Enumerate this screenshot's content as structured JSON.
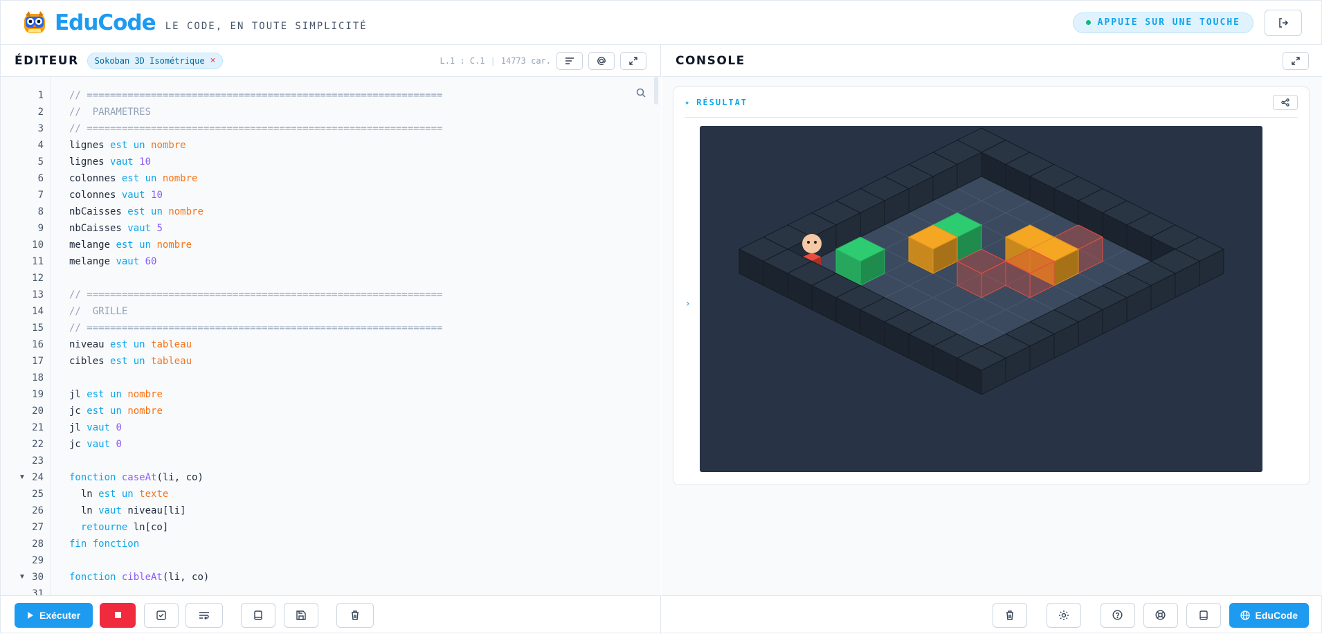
{
  "header": {
    "brand": "EduCode",
    "tagline": "LE CODE, EN TOUTE SIMPLICITÉ",
    "key_prompt": "APPUIE SUR UNE TOUCHE"
  },
  "editor": {
    "title": "ÉDITEUR",
    "file_tag": "Sokoban 3D Isométrique",
    "file_tag_close": "×",
    "cursor_pos": "L.1 : C.1",
    "char_count": "14773 car.",
    "lines": [
      {
        "n": "1",
        "tokens": [
          {
            "c": "t-comment",
            "t": "// ============================================================="
          }
        ]
      },
      {
        "n": "2",
        "tokens": [
          {
            "c": "t-comment",
            "t": "//  PARAMETRES"
          }
        ]
      },
      {
        "n": "3",
        "tokens": [
          {
            "c": "t-comment",
            "t": "// ============================================================="
          }
        ]
      },
      {
        "n": "4",
        "tokens": [
          {
            "c": "t-ident",
            "t": "lignes "
          },
          {
            "c": "t-kw",
            "t": "est un "
          },
          {
            "c": "t-type",
            "t": "nombre"
          }
        ]
      },
      {
        "n": "5",
        "tokens": [
          {
            "c": "t-ident",
            "t": "lignes "
          },
          {
            "c": "t-kw",
            "t": "vaut "
          },
          {
            "c": "t-num",
            "t": "10"
          }
        ]
      },
      {
        "n": "6",
        "tokens": [
          {
            "c": "t-ident",
            "t": "colonnes "
          },
          {
            "c": "t-kw",
            "t": "est un "
          },
          {
            "c": "t-type",
            "t": "nombre"
          }
        ]
      },
      {
        "n": "7",
        "tokens": [
          {
            "c": "t-ident",
            "t": "colonnes "
          },
          {
            "c": "t-kw",
            "t": "vaut "
          },
          {
            "c": "t-num",
            "t": "10"
          }
        ]
      },
      {
        "n": "8",
        "tokens": [
          {
            "c": "t-ident",
            "t": "nbCaisses "
          },
          {
            "c": "t-kw",
            "t": "est un "
          },
          {
            "c": "t-type",
            "t": "nombre"
          }
        ]
      },
      {
        "n": "9",
        "tokens": [
          {
            "c": "t-ident",
            "t": "nbCaisses "
          },
          {
            "c": "t-kw",
            "t": "vaut "
          },
          {
            "c": "t-num",
            "t": "5"
          }
        ]
      },
      {
        "n": "10",
        "tokens": [
          {
            "c": "t-ident",
            "t": "melange "
          },
          {
            "c": "t-kw",
            "t": "est un "
          },
          {
            "c": "t-type",
            "t": "nombre"
          }
        ]
      },
      {
        "n": "11",
        "tokens": [
          {
            "c": "t-ident",
            "t": "melange "
          },
          {
            "c": "t-kw",
            "t": "vaut "
          },
          {
            "c": "t-num",
            "t": "60"
          }
        ]
      },
      {
        "n": "12",
        "tokens": []
      },
      {
        "n": "13",
        "tokens": [
          {
            "c": "t-comment",
            "t": "// ============================================================="
          }
        ]
      },
      {
        "n": "14",
        "tokens": [
          {
            "c": "t-comment",
            "t": "//  GRILLE"
          }
        ]
      },
      {
        "n": "15",
        "tokens": [
          {
            "c": "t-comment",
            "t": "// ============================================================="
          }
        ]
      },
      {
        "n": "16",
        "tokens": [
          {
            "c": "t-ident",
            "t": "niveau "
          },
          {
            "c": "t-kw",
            "t": "est un "
          },
          {
            "c": "t-type",
            "t": "tableau"
          }
        ]
      },
      {
        "n": "17",
        "tokens": [
          {
            "c": "t-ident",
            "t": "cibles "
          },
          {
            "c": "t-kw",
            "t": "est un "
          },
          {
            "c": "t-type",
            "t": "tableau"
          }
        ]
      },
      {
        "n": "18",
        "tokens": []
      },
      {
        "n": "19",
        "tokens": [
          {
            "c": "t-ident",
            "t": "jl "
          },
          {
            "c": "t-kw",
            "t": "est un "
          },
          {
            "c": "t-type",
            "t": "nombre"
          }
        ]
      },
      {
        "n": "20",
        "tokens": [
          {
            "c": "t-ident",
            "t": "jc "
          },
          {
            "c": "t-kw",
            "t": "est un "
          },
          {
            "c": "t-type",
            "t": "nombre"
          }
        ]
      },
      {
        "n": "21",
        "tokens": [
          {
            "c": "t-ident",
            "t": "jl "
          },
          {
            "c": "t-kw",
            "t": "vaut "
          },
          {
            "c": "t-num",
            "t": "0"
          }
        ]
      },
      {
        "n": "22",
        "tokens": [
          {
            "c": "t-ident",
            "t": "jc "
          },
          {
            "c": "t-kw",
            "t": "vaut "
          },
          {
            "c": "t-num",
            "t": "0"
          }
        ]
      },
      {
        "n": "23",
        "tokens": []
      },
      {
        "n": "24",
        "fold": true,
        "tokens": [
          {
            "c": "t-kw",
            "t": "fonction "
          },
          {
            "c": "t-fn",
            "t": "caseAt"
          },
          {
            "c": "t-ident",
            "t": "(li, co)"
          }
        ]
      },
      {
        "n": "25",
        "tokens": [
          {
            "c": "t-ident",
            "t": "  ln "
          },
          {
            "c": "t-kw",
            "t": "est un "
          },
          {
            "c": "t-type",
            "t": "texte"
          }
        ]
      },
      {
        "n": "26",
        "tokens": [
          {
            "c": "t-ident",
            "t": "  ln "
          },
          {
            "c": "t-kw",
            "t": "vaut "
          },
          {
            "c": "t-ident",
            "t": "niveau[li]"
          }
        ]
      },
      {
        "n": "27",
        "tokens": [
          {
            "c": "t-kw",
            "t": "  retourne "
          },
          {
            "c": "t-ident",
            "t": "ln[co]"
          }
        ]
      },
      {
        "n": "28",
        "tokens": [
          {
            "c": "t-kw",
            "t": "fin fonction"
          }
        ]
      },
      {
        "n": "29",
        "tokens": []
      },
      {
        "n": "30",
        "fold": true,
        "tokens": [
          {
            "c": "t-kw",
            "t": "fonction "
          },
          {
            "c": "t-fn",
            "t": "cibleAt"
          },
          {
            "c": "t-ident",
            "t": "(li, co)"
          }
        ]
      },
      {
        "n": "31",
        "tokens": []
      }
    ]
  },
  "console": {
    "title": "CONSOLE",
    "result_label": "RÉSULTAT",
    "result_star": "✦",
    "chevron": "›"
  },
  "toolbar": {
    "run_label": "Exécuter",
    "educode_label": "EduCode"
  },
  "colors": {
    "brand": "#1d9bf0",
    "stop": "#ef2b3d",
    "box_orange": "#f5a623",
    "box_green": "#2ecc71",
    "target_red": "#e74c3c"
  }
}
